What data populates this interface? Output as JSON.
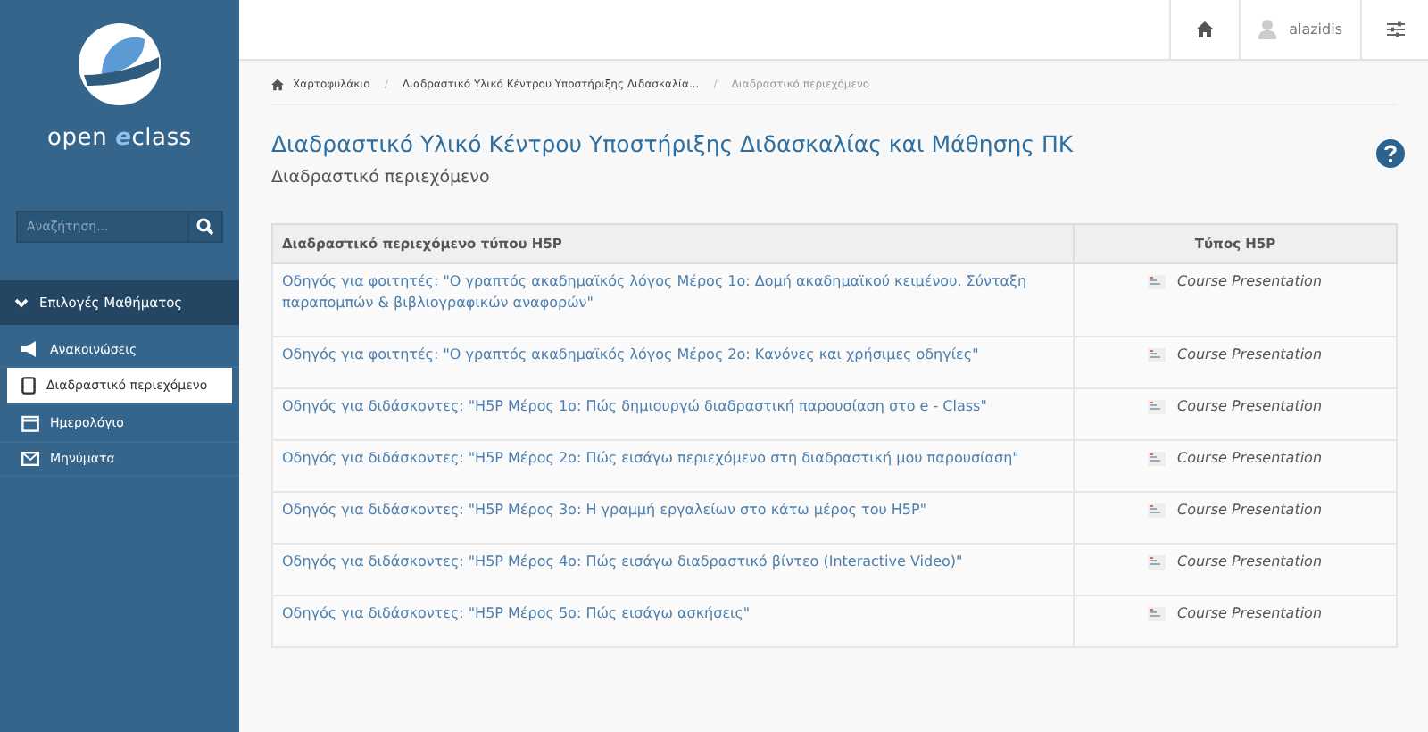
{
  "sidebar": {
    "logo": {
      "start": "open ",
      "accent": "e",
      "end": "class"
    },
    "search": {
      "placeholder": "Αναζήτηση..."
    },
    "section": {
      "label": "Επιλογές Μαθήματος",
      "expanded": true
    },
    "items": [
      {
        "kind": "megaphone",
        "label": "Ανακοινώσεις",
        "selected": false
      },
      {
        "kind": "tablet",
        "label": "Διαδραστικό περιεχόμενο",
        "selected": true
      },
      {
        "kind": "calendar",
        "label": "Ημερολόγιο",
        "selected": false
      },
      {
        "kind": "envelope",
        "label": "Μηνύματα",
        "selected": false
      }
    ]
  },
  "topbar": {
    "user": "alazidis"
  },
  "breadcrumb_separator": "/",
  "breadcrumb": [
    "Χαρτοφυλάκιο",
    "Διαδραστικό Υλικό Κέντρου Υποστήριξης Διδασκαλία...",
    "Διαδραστικό περιεχόμενο"
  ],
  "title": "Διαδραστικό Υλικό Κέντρου Υποστήριξης Διδασκαλίας και Μάθησης ΠΚ",
  "subtitle": "Διαδραστικό περιεχόμενο",
  "table": {
    "columns": [
      "Διαδραστικό περιεχόμενο τύπου H5P",
      "Τύπος H5P"
    ],
    "rows": [
      {
        "title": "Οδηγός για φοιτητές: \"Ο γραπτός ακαδημαϊκός λόγος Μέρος 1ο: Δομή ακαδημαϊκού κειμένου. Σύνταξη παραπομπών & βιβλιογραφικών αναφορών\"",
        "type": "Course Presentation"
      },
      {
        "title": "Οδηγός για φοιτητές: \"Ο γραπτός ακαδημαϊκός λόγος Μέρος 2ο: Κανόνες και χρήσιμες οδηγίες\"",
        "type": "Course Presentation"
      },
      {
        "title": "Οδηγός για διδάσκοντες: \"H5P Μέρος 1ο: Πώς δημιουργώ διαδραστική παρουσίαση στο e - Class\"",
        "type": "Course Presentation"
      },
      {
        "title": "Οδηγός για διδάσκοντες: \"H5P Μέρος 2ο: Πώς εισάγω περιεχόμενο στη διαδραστική μου παρουσίαση\"",
        "type": "Course Presentation"
      },
      {
        "title": "Οδηγός για διδάσκοντες: \"H5P Μέρος 3ο: Η γραμμή εργαλείων στο κάτω μέρος του H5P\"",
        "type": "Course Presentation"
      },
      {
        "title": "Οδηγός για διδάσκοντες: \"H5P Μέρος 4ο: Πώς εισάγω διαδραστικό βίντεο (Interactive Video)\"",
        "type": "Course Presentation"
      },
      {
        "title": "Οδηγός για διδάσκοντες: \"H5P Μέρος 5ο: Πώς εισάγω ασκήσεις\"",
        "type": "Course Presentation"
      }
    ]
  }
}
